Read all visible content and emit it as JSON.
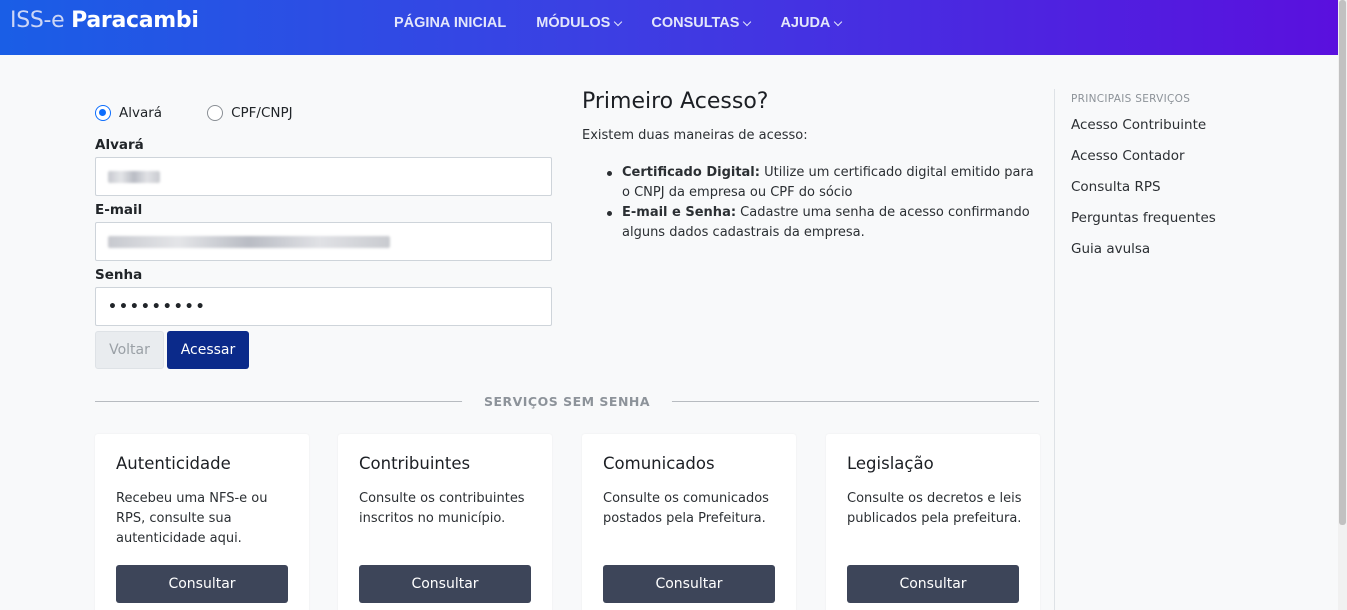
{
  "brand": {
    "light": "ISS-e",
    "bold": "Paracambi"
  },
  "nav": [
    {
      "label": "PÁGINA INICIAL",
      "dropdown": false
    },
    {
      "label": "MÓDULOS",
      "dropdown": true
    },
    {
      "label": "CONSULTAS",
      "dropdown": true
    },
    {
      "label": "AJUDA",
      "dropdown": true
    }
  ],
  "login": {
    "radio_options": [
      {
        "label": "Alvará",
        "checked": true
      },
      {
        "label": "CPF/CNPJ",
        "checked": false
      }
    ],
    "alvara_label": "Alvará",
    "email_label": "E-mail",
    "senha_label": "Senha",
    "senha_value": "•••••••••",
    "voltar_label": "Voltar",
    "acessar_label": "Acessar"
  },
  "primeiro_acesso": {
    "title": "Primeiro Acesso?",
    "intro": "Existem duas maneiras de acesso:",
    "items": [
      {
        "bold": "Certificado Digital:",
        "text": " Utilize um certificado digital emitido para o CNPJ da empresa ou CPF do sócio"
      },
      {
        "bold": "E-mail e Senha:",
        "text": " Cadastre uma senha de acesso confirmando alguns dados cadastrais da empresa."
      }
    ]
  },
  "divider_label": "SERVIÇOS SEM SENHA",
  "sidebar": {
    "title": "PRINCIPAIS SERVIÇOS",
    "items": [
      "Acesso Contribuinte",
      "Acesso Contador",
      "Consulta RPS",
      "Perguntas frequentes",
      "Guia avulsa"
    ]
  },
  "cards": [
    {
      "title": "Autenticidade",
      "text": "Recebeu uma NFS-e ou RPS, consulte sua autenticidade aqui.",
      "button": "Consultar"
    },
    {
      "title": "Contribuintes",
      "text": "Consulte os contribuintes inscritos no município.",
      "button": "Consultar"
    },
    {
      "title": "Comunicados",
      "text": "Consulte os comunicados postados pela Prefeitura.",
      "button": "Consultar"
    },
    {
      "title": "Legislação",
      "text": "Consulte os decretos e leis publicados pela prefeitura.",
      "button": "Consultar"
    }
  ],
  "colors": {
    "primary_button": "#0b2a8a",
    "card_button": "#3d4559",
    "radio_accent": "#0d6efd"
  }
}
